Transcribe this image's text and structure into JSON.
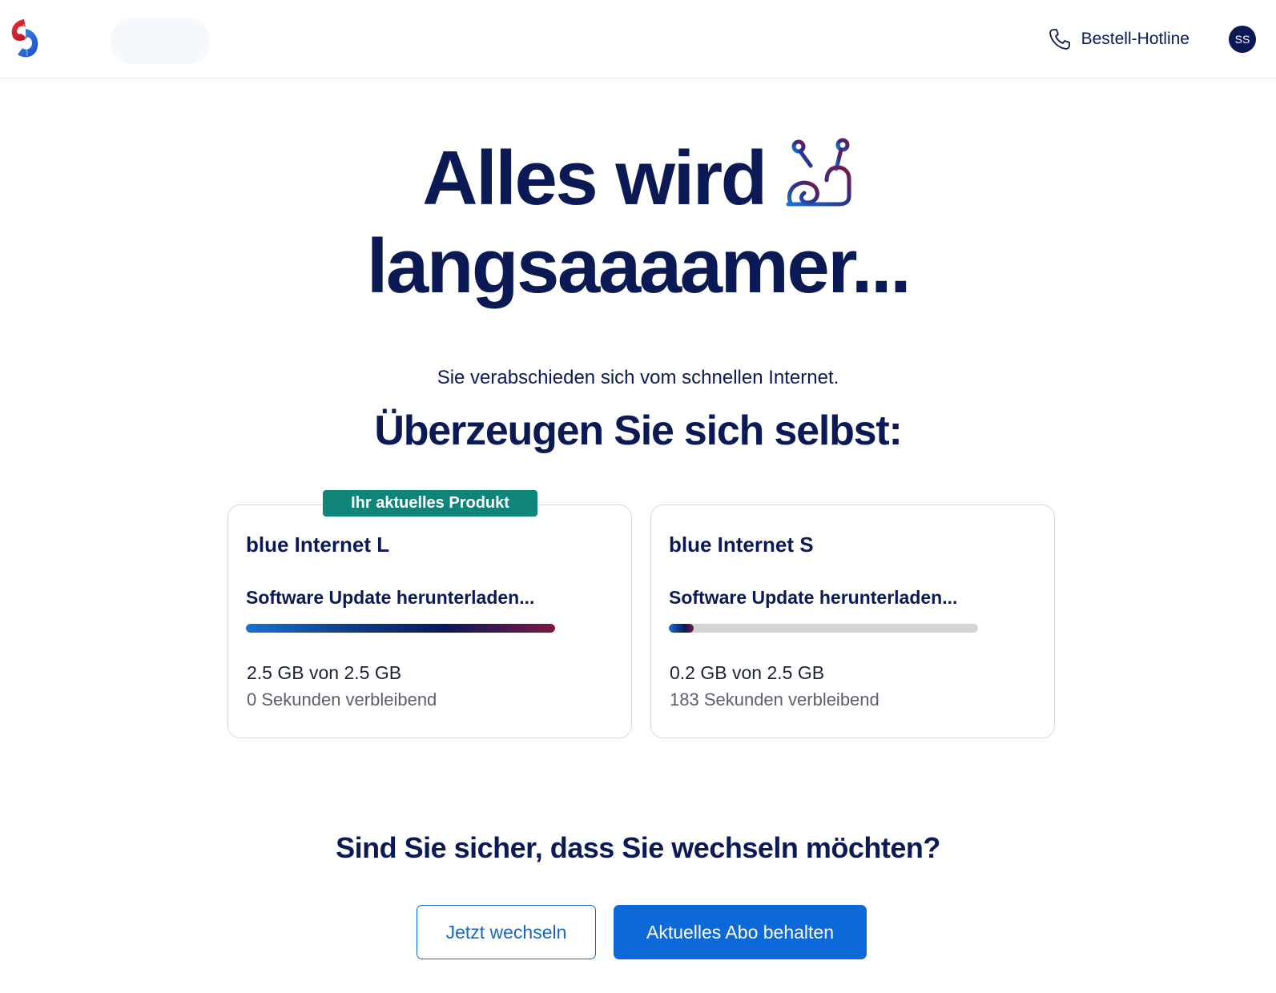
{
  "header": {
    "hotline_label": "Bestell-Hotline",
    "avatar_initials": "SS"
  },
  "hero": {
    "title_line1": "Alles wird",
    "title_line2": "langsaaaamer..."
  },
  "subtitle": "Sie verabschieden sich vom schnellen Internet.",
  "section_heading": "Überzeugen Sie sich selbst:",
  "cards": [
    {
      "badge": "Ihr aktuelles Produkt",
      "title": "blue Internet L",
      "status": "Software Update herunterladen...",
      "progress": 1.0,
      "amount": "2.5 GB von 2.5 GB",
      "remaining": "0 Sekunden verbleibend"
    },
    {
      "title": "blue Internet S",
      "status": "Software Update herunterladen...",
      "progress": 0.08,
      "amount": "0.2 GB von 2.5 GB",
      "remaining": "183 Sekunden verbleibend"
    }
  ],
  "question": "Sind Sie sicher, dass Sie wechseln möchten?",
  "buttons": {
    "switch_label": "Jetzt wechseln",
    "keep_label": "Aktuelles Abo behalten"
  },
  "colors": {
    "navy": "#0b1a55",
    "primary_blue": "#0d69d8",
    "badge_teal": "#0f8579",
    "track_grey": "#d4d4d6"
  },
  "icons": {
    "logo": "swisscom-logo",
    "hotline": "phone-icon",
    "hero": "snail-icon"
  }
}
